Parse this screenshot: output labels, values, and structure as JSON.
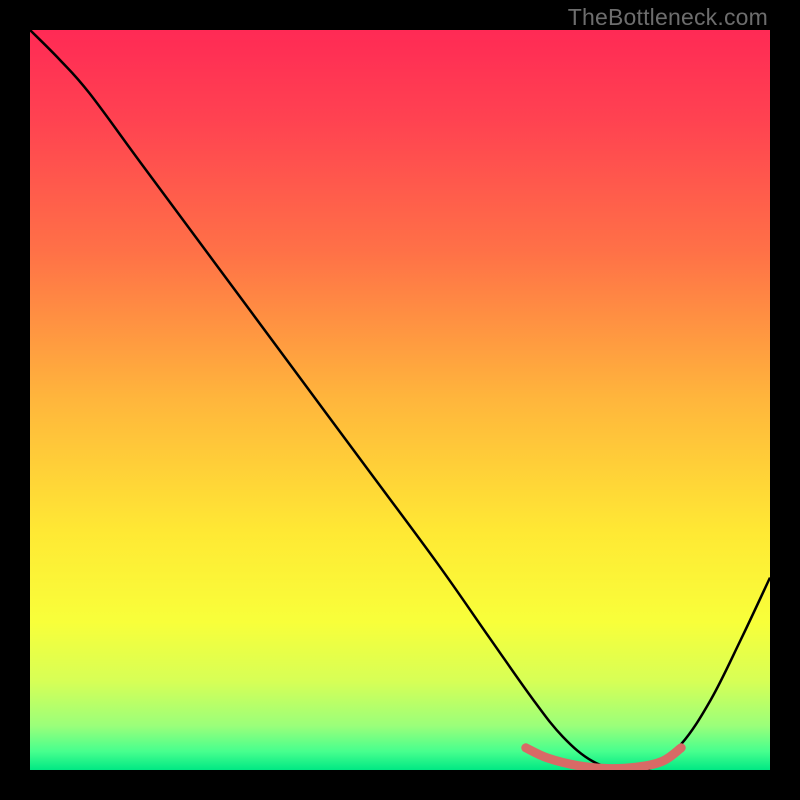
{
  "watermark": "TheBottleneck.com",
  "chart_data": {
    "type": "line",
    "title": "",
    "xlabel": "",
    "ylabel": "",
    "xlim": [
      0,
      100
    ],
    "ylim": [
      0,
      100
    ],
    "gradient_stops": [
      {
        "offset": 0.0,
        "color": "#ff2a55"
      },
      {
        "offset": 0.12,
        "color": "#ff4251"
      },
      {
        "offset": 0.3,
        "color": "#ff7147"
      },
      {
        "offset": 0.5,
        "color": "#ffb63c"
      },
      {
        "offset": 0.68,
        "color": "#ffe934"
      },
      {
        "offset": 0.8,
        "color": "#f8ff3a"
      },
      {
        "offset": 0.88,
        "color": "#d7ff56"
      },
      {
        "offset": 0.94,
        "color": "#9bff7a"
      },
      {
        "offset": 0.975,
        "color": "#47ff8e"
      },
      {
        "offset": 1.0,
        "color": "#00e884"
      }
    ],
    "series": [
      {
        "name": "bottleneck-curve",
        "stroke": "#000000",
        "stroke_width": 2.5,
        "x": [
          0,
          4,
          8,
          15,
          25,
          35,
          45,
          55,
          62,
          68,
          72,
          76,
          80,
          84,
          88,
          92,
          96,
          100
        ],
        "y": [
          100,
          96,
          91.5,
          82,
          68.5,
          55,
          41.5,
          28,
          18,
          9.5,
          4.5,
          1.2,
          0,
          0.3,
          3.5,
          9.5,
          17.5,
          26
        ]
      },
      {
        "name": "highlight-band",
        "stroke": "#d86a66",
        "stroke_width": 9,
        "x": [
          67,
          70,
          74,
          78,
          82,
          85.5,
          88
        ],
        "y": [
          3.0,
          1.6,
          0.6,
          0.2,
          0.4,
          1.2,
          3.0
        ]
      }
    ]
  }
}
